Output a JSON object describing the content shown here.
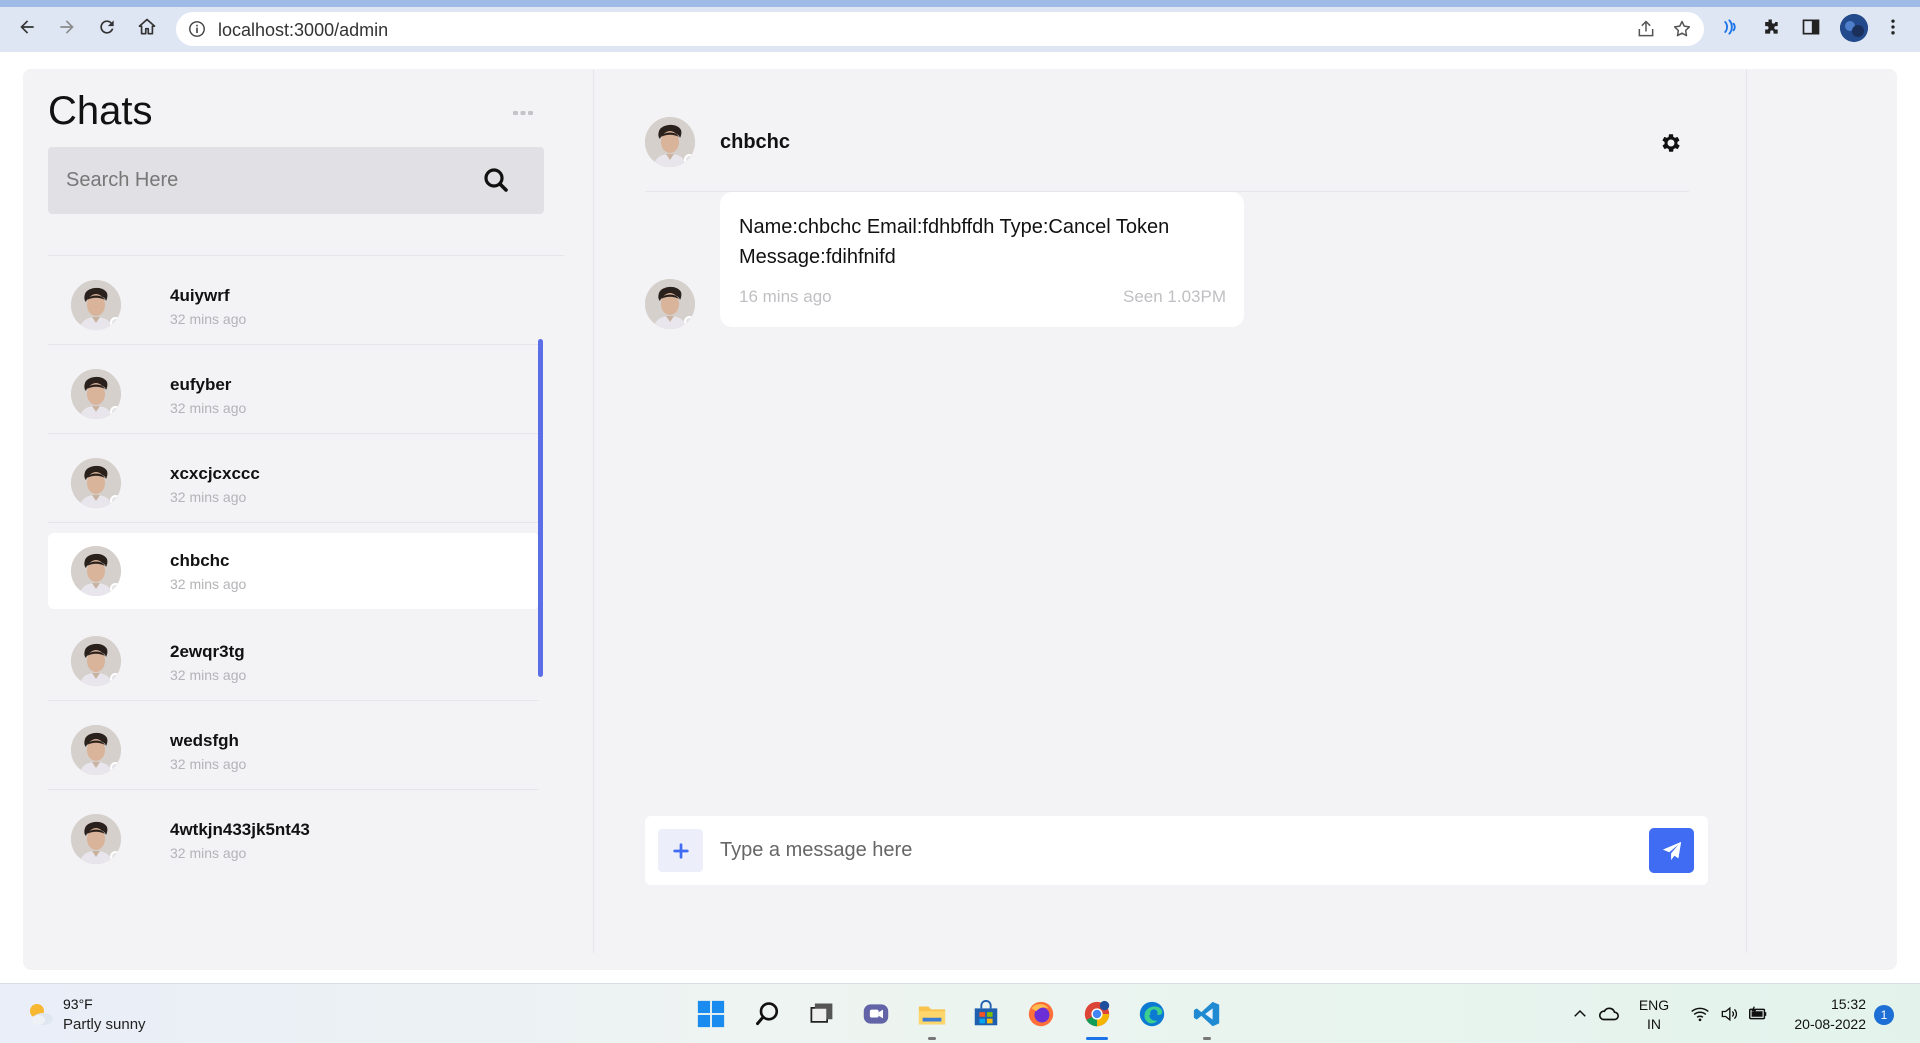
{
  "browser": {
    "url": "localhost:3000/admin",
    "back_icon": "arrow-left-icon",
    "forward_icon": "arrow-right-icon",
    "reload_icon": "reload-icon",
    "home_icon": "home-icon"
  },
  "sidebar": {
    "title": "Chats",
    "search_placeholder": "Search Here",
    "chats": [
      {
        "name": "4uiywrf",
        "time": "32 mins ago"
      },
      {
        "name": "eufyber",
        "time": "32 mins ago"
      },
      {
        "name": "xcxcjcxccc",
        "time": "32 mins ago"
      },
      {
        "name": "chbchc",
        "time": "32 mins ago",
        "active": true
      },
      {
        "name": "2ewqr3tg",
        "time": "32 mins ago"
      },
      {
        "name": "wedsfgh",
        "time": "32 mins ago"
      },
      {
        "name": "4wtkjn433jk5nt43",
        "time": "32 mins ago"
      }
    ]
  },
  "conversation": {
    "contact_name": "chbchc",
    "messages": [
      {
        "text": "Name:chbchc Email:fdhbffdh Type:Cancel Token Message:fdihfnifd",
        "time": "16 mins ago",
        "status": "Seen 1.03PM"
      }
    ],
    "composer_placeholder": "Type a message here"
  },
  "taskbar": {
    "weather_temp": "93°F",
    "weather_desc": "Partly sunny",
    "language": "ENG",
    "region": "IN",
    "time": "15:32",
    "date": "20-08-2022",
    "notification_count": "1"
  },
  "colors": {
    "accent": "#3f6cf2",
    "scrollbar": "#5b6ee8",
    "app_background": "#f3f3f6"
  }
}
